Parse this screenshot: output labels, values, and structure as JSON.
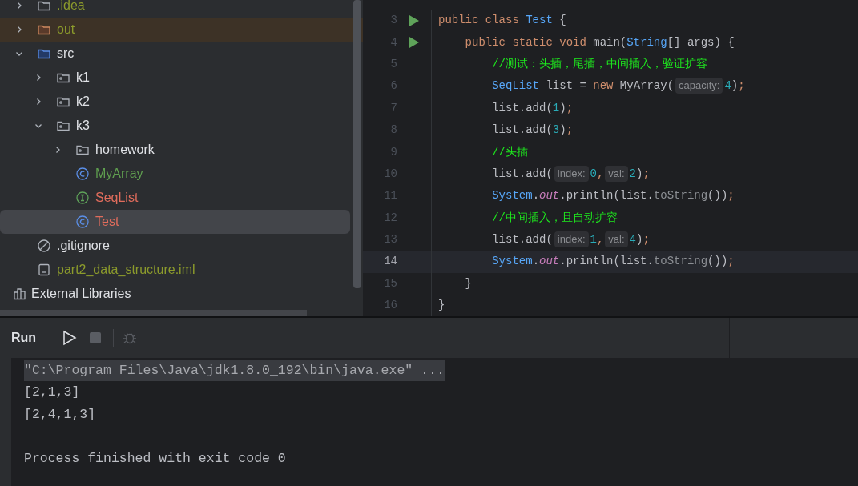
{
  "project_tree": [
    {
      "label": ".idea",
      "kind": "folder",
      "color": "#8c9b2c",
      "expanded": false,
      "selected": false
    },
    {
      "label": "out",
      "kind": "excluded-folder",
      "color": "#8c9b2c",
      "expanded": false,
      "selected": false
    },
    {
      "label": "src",
      "kind": "source-folder",
      "color": "#dfe1e5",
      "expanded": true,
      "selected": false,
      "children": [
        {
          "label": "k1",
          "kind": "package",
          "color": "#dfe1e5",
          "expanded": false,
          "selected": false
        },
        {
          "label": "k2",
          "kind": "package",
          "color": "#dfe1e5",
          "expanded": false,
          "selected": false
        },
        {
          "label": "k3",
          "kind": "package",
          "color": "#dfe1e5",
          "expanded": true,
          "selected": false,
          "children": [
            {
              "label": "homework",
              "kind": "package",
              "color": "#dfe1e5",
              "expanded": false,
              "selected": false
            },
            {
              "label": "MyArray",
              "kind": "class",
              "color": "#5f9e4f",
              "selected": false
            },
            {
              "label": "SeqList",
              "kind": "interface",
              "color": "#e06c5c",
              "selected": false
            },
            {
              "label": "Test",
              "kind": "class",
              "color": "#e06c5c",
              "selected": true
            }
          ]
        }
      ]
    },
    {
      "label": ".gitignore",
      "kind": "ignore-file",
      "color": "#dfe1e5",
      "selected": false
    },
    {
      "label": "part2_data_structure.iml",
      "kind": "module-file",
      "color": "#8c9b2c",
      "selected": false
    }
  ],
  "external_libraries": {
    "label": "External Libraries"
  },
  "editor": {
    "lines": [
      {
        "number": "3",
        "runnable": true,
        "current": false,
        "tokens": [
          {
            "kind": "keyword",
            "text": "public class "
          },
          {
            "kind": "type",
            "text": "Test"
          },
          {
            "kind": "plain",
            "text": " {"
          }
        ]
      },
      {
        "number": "4",
        "runnable": true,
        "current": false,
        "tokens": [
          {
            "kind": "keyword",
            "text": "    public static void "
          },
          {
            "kind": "plain",
            "text": "main("
          },
          {
            "kind": "type",
            "text": "String"
          },
          {
            "kind": "plain",
            "text": "[] args) {"
          }
        ]
      },
      {
        "number": "5",
        "runnable": false,
        "current": false,
        "tokens": [
          {
            "kind": "comment",
            "text": "        //测试：头插，尾插，中间插入，验证扩容"
          }
        ]
      },
      {
        "number": "6",
        "runnable": false,
        "current": false,
        "tokens": [
          {
            "kind": "type",
            "text": "        SeqList"
          },
          {
            "kind": "plain",
            "text": " list = "
          },
          {
            "kind": "keyword",
            "text": "new "
          },
          {
            "kind": "plain",
            "text": "MyArray("
          },
          {
            "kind": "hint",
            "text": "capacity:"
          },
          {
            "kind": "number",
            "text": "4"
          },
          {
            "kind": "plain",
            "text": ")"
          },
          {
            "kind": "punct",
            "text": ";"
          }
        ]
      },
      {
        "number": "7",
        "runnable": false,
        "current": false,
        "tokens": [
          {
            "kind": "plain",
            "text": "        list.add("
          },
          {
            "kind": "number",
            "text": "1"
          },
          {
            "kind": "plain",
            "text": ")"
          },
          {
            "kind": "punct",
            "text": ";"
          }
        ]
      },
      {
        "number": "8",
        "runnable": false,
        "current": false,
        "tokens": [
          {
            "kind": "plain",
            "text": "        list.add("
          },
          {
            "kind": "number",
            "text": "3"
          },
          {
            "kind": "plain",
            "text": ")"
          },
          {
            "kind": "punct",
            "text": ";"
          }
        ]
      },
      {
        "number": "9",
        "runnable": false,
        "current": false,
        "tokens": [
          {
            "kind": "comment",
            "text": "        //头插"
          }
        ]
      },
      {
        "number": "10",
        "runnable": false,
        "current": false,
        "tokens": [
          {
            "kind": "plain",
            "text": "        list.add("
          },
          {
            "kind": "hint",
            "text": "index:"
          },
          {
            "kind": "number",
            "text": "0"
          },
          {
            "kind": "punct",
            "text": ","
          },
          {
            "kind": "hint",
            "text": "val:"
          },
          {
            "kind": "number",
            "text": "2"
          },
          {
            "kind": "plain",
            "text": ")"
          },
          {
            "kind": "punct",
            "text": ";"
          }
        ]
      },
      {
        "number": "11",
        "runnable": false,
        "current": false,
        "tokens": [
          {
            "kind": "type",
            "text": "        System"
          },
          {
            "kind": "plain",
            "text": "."
          },
          {
            "kind": "field",
            "text": "out"
          },
          {
            "kind": "plain",
            "text": ".println(list."
          },
          {
            "kind": "method",
            "text": "toString"
          },
          {
            "kind": "plain",
            "text": "())"
          },
          {
            "kind": "punct",
            "text": ";"
          }
        ]
      },
      {
        "number": "12",
        "runnable": false,
        "current": false,
        "tokens": [
          {
            "kind": "comment",
            "text": "        //中间插入，且自动扩容"
          }
        ]
      },
      {
        "number": "13",
        "runnable": false,
        "current": false,
        "tokens": [
          {
            "kind": "plain",
            "text": "        list.add("
          },
          {
            "kind": "hint",
            "text": "index:"
          },
          {
            "kind": "number",
            "text": "1"
          },
          {
            "kind": "punct",
            "text": ","
          },
          {
            "kind": "hint",
            "text": "val:"
          },
          {
            "kind": "number",
            "text": "4"
          },
          {
            "kind": "plain",
            "text": ")"
          },
          {
            "kind": "punct",
            "text": ";"
          }
        ]
      },
      {
        "number": "14",
        "runnable": false,
        "current": true,
        "tokens": [
          {
            "kind": "type",
            "text": "        System"
          },
          {
            "kind": "plain",
            "text": "."
          },
          {
            "kind": "field",
            "text": "out"
          },
          {
            "kind": "plain",
            "text": ".println(list."
          },
          {
            "kind": "method",
            "text": "toString"
          },
          {
            "kind": "plain",
            "text": "())"
          },
          {
            "kind": "punct",
            "text": ";"
          }
        ]
      },
      {
        "number": "15",
        "runnable": false,
        "current": false,
        "tokens": [
          {
            "kind": "plain",
            "text": "    }"
          }
        ]
      },
      {
        "number": "16",
        "runnable": false,
        "current": false,
        "tokens": [
          {
            "kind": "plain",
            "text": "}"
          }
        ]
      }
    ]
  },
  "run_panel": {
    "title": "Run",
    "console": [
      {
        "kind": "command",
        "text": "\"C:\\Program Files\\Java\\jdk1.8.0_192\\bin\\java.exe\" ..."
      },
      {
        "kind": "output",
        "text": "[2,1,3]"
      },
      {
        "kind": "output",
        "text": "[2,4,1,3]"
      },
      {
        "kind": "blank"
      },
      {
        "kind": "output",
        "text": "Process finished with exit code 0"
      }
    ]
  }
}
